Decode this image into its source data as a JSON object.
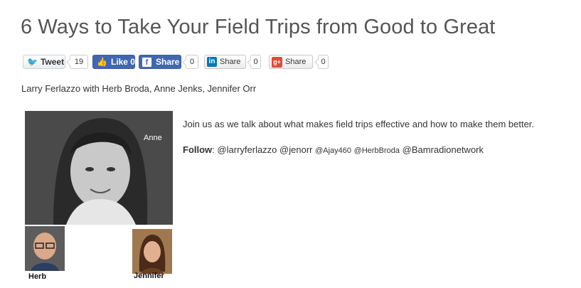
{
  "article": {
    "title": "6 Ways to Take Your Field Trips from Good to Great",
    "byline": "Larry Ferlazzo with Herb Broda, Anne Jenks, Jennifer Orr",
    "description": "Join us as we talk about what makes field trips effective and how to make them better.",
    "follow_label": "Follow",
    "follow_colon": ":",
    "handles": [
      "@larryferlazzo",
      "@jenorr",
      "@Ajay460",
      "@HerbBroda",
      "@Bamradionetwork"
    ]
  },
  "social": {
    "tweet_label": "Tweet",
    "tweet_count": "19",
    "like_label": "Like 0",
    "fb_share_label": "Share",
    "fb_share_count": "0",
    "linkedin_label": "Share",
    "linkedin_count": "0",
    "gplus_label": "Share",
    "gplus_count": "0"
  },
  "photo": {
    "main_caption": "Anne",
    "left_caption": "Herb",
    "right_caption": "Jennifer"
  },
  "icons": {
    "twitter": "twitter-bird-icon",
    "facebook_like": "thumbs-up-icon",
    "facebook": "facebook-f-icon",
    "linkedin": "linkedin-in-icon",
    "gplus": "google-plus-icon"
  },
  "colors": {
    "title": "#555555",
    "facebook": "#4267b2",
    "linkedin": "#0077b5",
    "gplus": "#dd4b39",
    "twitter": "#1da1f2"
  }
}
